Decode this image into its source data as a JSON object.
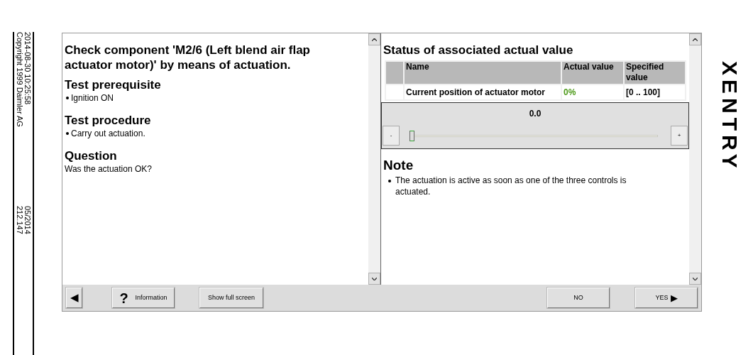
{
  "side_info": {
    "timestamp": "2014-08-30 10:25:58",
    "copyright": "Copyright 1999 Daimler AG",
    "date": "05/2014",
    "version": "212.147"
  },
  "logo": "XENTRY",
  "left_pane": {
    "title": "Check component 'M2/6 (Left blend air flap actuator motor)' by means of actuation.",
    "sections": [
      {
        "heading": "Test prerequisite",
        "kind": "bullets",
        "items": [
          "Ignition ON"
        ]
      },
      {
        "heading": "Test procedure",
        "kind": "bullets",
        "items": [
          "Carry out actuation."
        ]
      },
      {
        "heading": "Question",
        "kind": "text",
        "text": "Was the actuation OK?"
      }
    ]
  },
  "right_pane": {
    "title": "Status of associated actual value",
    "table": {
      "columns": [
        "Name",
        "Actual value",
        "Specified value"
      ],
      "rows": [
        [
          "Current position of actuator motor",
          "0%",
          "[0 .. 100]"
        ]
      ]
    },
    "slider": {
      "reading": "0.0",
      "level": 0,
      "minus": "-",
      "plus": "+"
    },
    "note": {
      "heading": "Note",
      "items": [
        "The actuation is active as soon as one of the three controls is actuated."
      ]
    }
  },
  "toolbar": {
    "back": "◀",
    "info_icon": "?",
    "info": "Information",
    "full_screen": "Show full screen",
    "no": "NO",
    "yes": "YES",
    "yes_arrow": "▶"
  }
}
